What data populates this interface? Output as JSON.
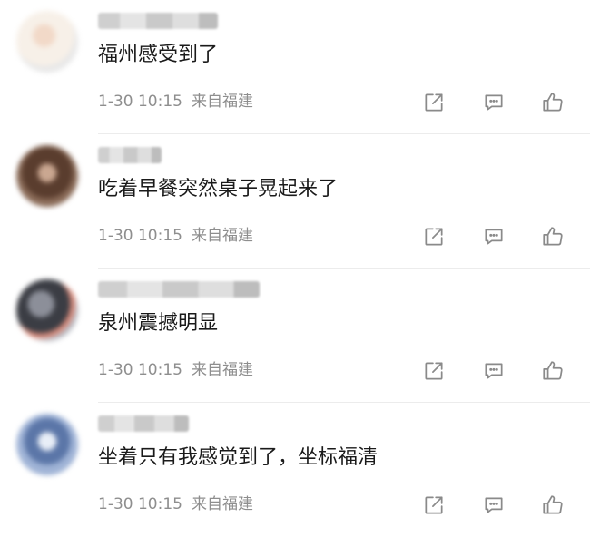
{
  "comments": [
    {
      "text": "福州感受到了",
      "time": "1-30 10:15",
      "location": "来自福建"
    },
    {
      "text": "吃着早餐突然桌子晃起来了",
      "time": "1-30 10:15",
      "location": "来自福建"
    },
    {
      "text": "泉州震撼明显",
      "time": "1-30 10:15",
      "location": "来自福建"
    },
    {
      "text": "坐着只有我感觉到了，坐标福清",
      "time": "1-30 10:15",
      "location": "来自福建"
    }
  ],
  "icons": {
    "share": "share-icon",
    "reply": "comment-icon",
    "like": "thumbs-up-icon",
    "color": "#8a8a8a"
  }
}
